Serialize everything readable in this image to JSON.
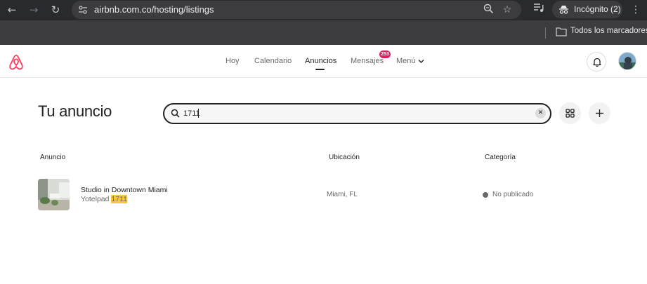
{
  "browser": {
    "url": "airbnb.com.co/hosting/listings",
    "incognito_label": "Incógnito (2)",
    "bookmarks_label": "Todos los marcadores"
  },
  "header": {
    "nav": {
      "today": "Hoy",
      "calendar": "Calendario",
      "listings": "Anuncios",
      "messages": "Mensajes",
      "menu": "Menú"
    },
    "messages_badge": "253",
    "brand_color": "#FF385C"
  },
  "main": {
    "title": "Tu anuncio",
    "search": {
      "value": "1711"
    },
    "columns": {
      "listing": "Anuncio",
      "location": "Ubicación",
      "category": "Categoría"
    },
    "rows": [
      {
        "name": "Studio in Downtown Miami",
        "subtitle_prefix": "Yotelpad ",
        "subtitle_match": "1711",
        "location": "Miami, FL",
        "status": "No publicado"
      }
    ]
  }
}
